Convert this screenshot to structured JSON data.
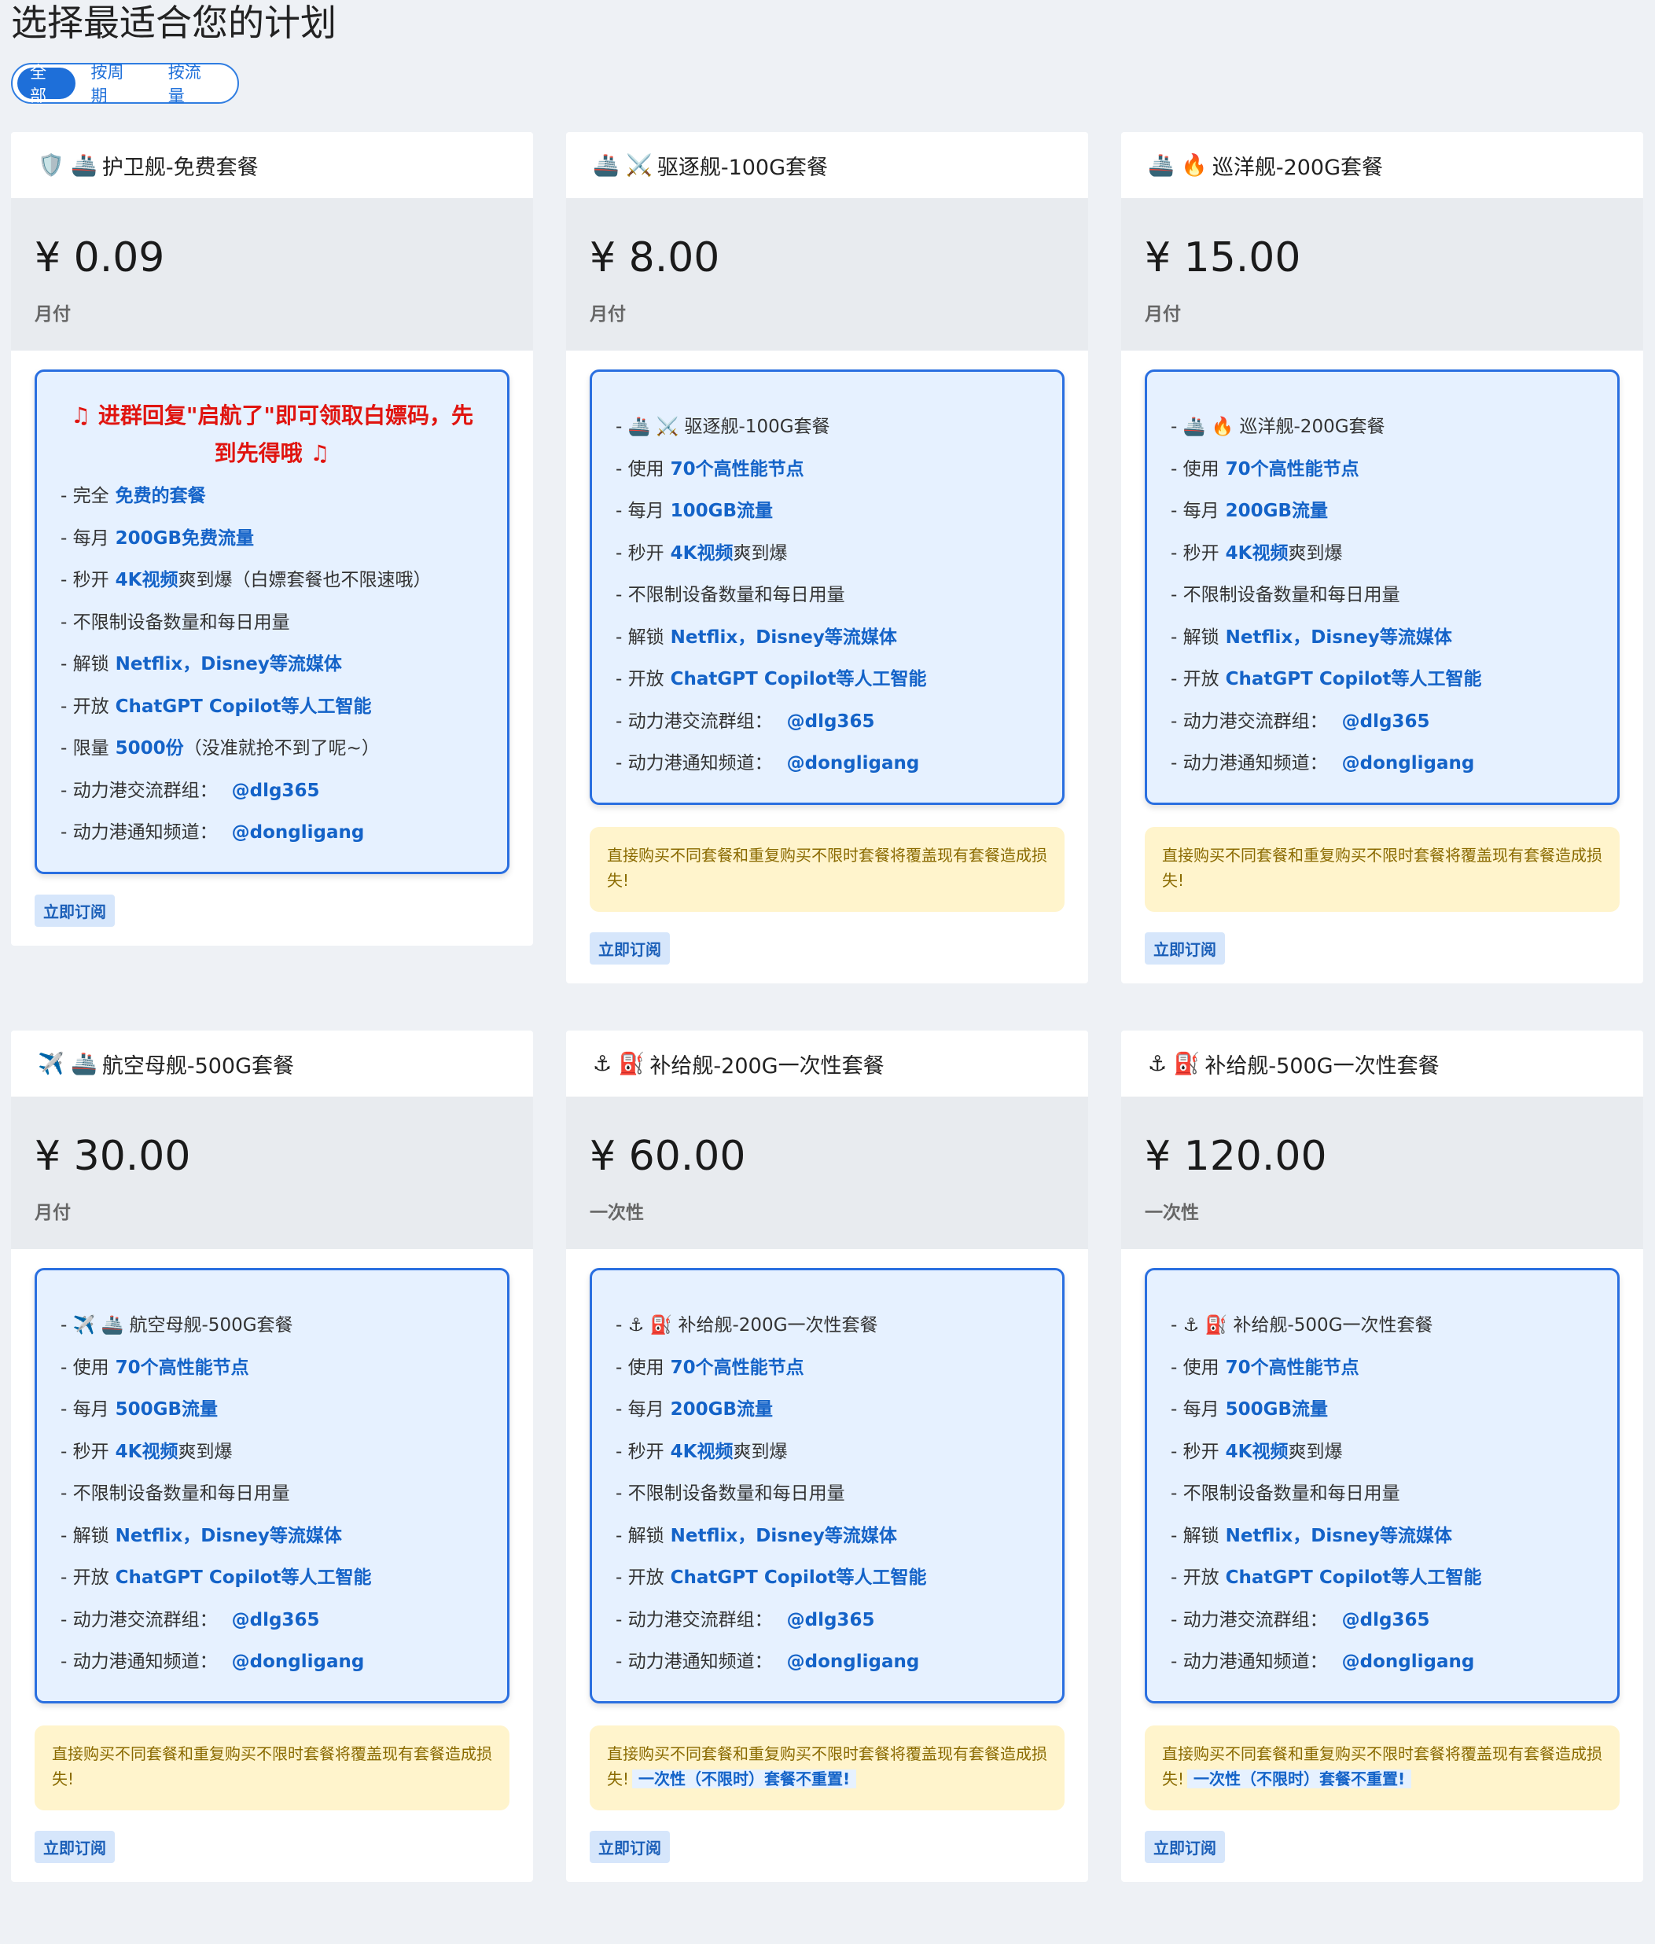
{
  "page_title": "选择最适合您的计划",
  "filters": [
    {
      "label": "全部",
      "active": true
    },
    {
      "label": "按周期",
      "active": false
    },
    {
      "label": "按流量",
      "active": false
    }
  ],
  "subscribe_label": "立即订阅",
  "note_text": "直接购买不同套餐和重复购买不限时套餐将覆盖现有套餐造成损失!",
  "note_extra": "一次性（不限时）套餐不重置!",
  "plans": [
    {
      "emoji": "🛡️ 🚢",
      "name": "护卫舰-免费套餐",
      "price": "¥ 0.09",
      "period": "月付",
      "promo": "♫ 进群回复\"启航了\"即可领取白嫖码，先到先得哦 ♫",
      "lines": [
        {
          "pre": "- 完全",
          "hl": "免费的套餐",
          "post": ""
        },
        {
          "pre": "- 每月",
          "hl": "200GB免费流量",
          "post": ""
        },
        {
          "pre": "- 秒开",
          "hl": "4K视频",
          "post": "爽到爆（白嫖套餐也不限速哦）"
        },
        {
          "pre": "- 不限制设备数量和每日用量",
          "hl": "",
          "post": ""
        },
        {
          "pre": "- 解锁",
          "hl": "Netflix，Disney等流媒体",
          "post": ""
        },
        {
          "pre": "- 开放",
          "hl": "ChatGPT Copilot等人工智能",
          "post": ""
        },
        {
          "pre": "- 限量",
          "hl": "5000份",
          "post": "（没准就抢不到了呢~）"
        },
        {
          "pre": "- 动力港交流群组：",
          "hl": "@dlg365",
          "post": ""
        },
        {
          "pre": "- 动力港通知频道：",
          "hl": "@dongligang",
          "post": ""
        }
      ],
      "note": false,
      "note_extra": false
    },
    {
      "emoji": "🚢 ⚔️",
      "name": "驱逐舰-100G套餐",
      "price": "¥ 8.00",
      "period": "月付",
      "promo": "",
      "lines": [
        {
          "pre": "- 🚢 ⚔️ 驱逐舰-100G套餐",
          "hl": "",
          "post": ""
        },
        {
          "pre": "- 使用",
          "hl": "70个高性能节点",
          "post": ""
        },
        {
          "pre": "- 每月",
          "hl": "100GB流量",
          "post": ""
        },
        {
          "pre": "- 秒开",
          "hl": "4K视频",
          "post": "爽到爆"
        },
        {
          "pre": "- 不限制设备数量和每日用量",
          "hl": "",
          "post": ""
        },
        {
          "pre": "- 解锁",
          "hl": "Netflix，Disney等流媒体",
          "post": ""
        },
        {
          "pre": "- 开放",
          "hl": "ChatGPT Copilot等人工智能",
          "post": ""
        },
        {
          "pre": "- 动力港交流群组：",
          "hl": "@dlg365",
          "post": ""
        },
        {
          "pre": "- 动力港通知频道：",
          "hl": "@dongligang",
          "post": ""
        }
      ],
      "note": true,
      "note_extra": false
    },
    {
      "emoji": "🚢 🔥",
      "name": "巡洋舰-200G套餐",
      "price": "¥ 15.00",
      "period": "月付",
      "promo": "",
      "lines": [
        {
          "pre": "- 🚢 🔥 巡洋舰-200G套餐",
          "hl": "",
          "post": ""
        },
        {
          "pre": "- 使用",
          "hl": "70个高性能节点",
          "post": ""
        },
        {
          "pre": "- 每月",
          "hl": "200GB流量",
          "post": ""
        },
        {
          "pre": "- 秒开",
          "hl": "4K视频",
          "post": "爽到爆"
        },
        {
          "pre": "- 不限制设备数量和每日用量",
          "hl": "",
          "post": ""
        },
        {
          "pre": "- 解锁",
          "hl": "Netflix，Disney等流媒体",
          "post": ""
        },
        {
          "pre": "- 开放",
          "hl": "ChatGPT Copilot等人工智能",
          "post": ""
        },
        {
          "pre": "- 动力港交流群组：",
          "hl": "@dlg365",
          "post": ""
        },
        {
          "pre": "- 动力港通知频道：",
          "hl": "@dongligang",
          "post": ""
        }
      ],
      "note": true,
      "note_extra": false
    },
    {
      "emoji": "✈️ 🚢",
      "name": "航空母舰-500G套餐",
      "price": "¥ 30.00",
      "period": "月付",
      "promo": "",
      "lines": [
        {
          "pre": "- ✈️ 🚢 航空母舰-500G套餐",
          "hl": "",
          "post": ""
        },
        {
          "pre": "- 使用",
          "hl": "70个高性能节点",
          "post": ""
        },
        {
          "pre": "- 每月",
          "hl": "500GB流量",
          "post": ""
        },
        {
          "pre": "- 秒开",
          "hl": "4K视频",
          "post": "爽到爆"
        },
        {
          "pre": "- 不限制设备数量和每日用量",
          "hl": "",
          "post": ""
        },
        {
          "pre": "- 解锁",
          "hl": "Netflix，Disney等流媒体",
          "post": ""
        },
        {
          "pre": "- 开放",
          "hl": "ChatGPT Copilot等人工智能",
          "post": ""
        },
        {
          "pre": "- 动力港交流群组：",
          "hl": "@dlg365",
          "post": ""
        },
        {
          "pre": "- 动力港通知频道：",
          "hl": "@dongligang",
          "post": ""
        }
      ],
      "note": true,
      "note_extra": false
    },
    {
      "emoji": "⚓ ⛽",
      "name": "补给舰-200G一次性套餐",
      "price": "¥ 60.00",
      "period": "一次性",
      "promo": "",
      "lines": [
        {
          "pre": "- ⚓ ⛽ 补给舰-200G一次性套餐",
          "hl": "",
          "post": ""
        },
        {
          "pre": "- 使用",
          "hl": "70个高性能节点",
          "post": ""
        },
        {
          "pre": "- 每月",
          "hl": "200GB流量",
          "post": ""
        },
        {
          "pre": "- 秒开",
          "hl": "4K视频",
          "post": "爽到爆"
        },
        {
          "pre": "- 不限制设备数量和每日用量",
          "hl": "",
          "post": ""
        },
        {
          "pre": "- 解锁",
          "hl": "Netflix，Disney等流媒体",
          "post": ""
        },
        {
          "pre": "- 开放",
          "hl": "ChatGPT Copilot等人工智能",
          "post": ""
        },
        {
          "pre": "- 动力港交流群组：",
          "hl": "@dlg365",
          "post": ""
        },
        {
          "pre": "- 动力港通知频道：",
          "hl": "@dongligang",
          "post": ""
        }
      ],
      "note": true,
      "note_extra": true
    },
    {
      "emoji": "⚓ ⛽",
      "name": "补给舰-500G一次性套餐",
      "price": "¥ 120.00",
      "period": "一次性",
      "promo": "",
      "lines": [
        {
          "pre": "- ⚓ ⛽ 补给舰-500G一次性套餐",
          "hl": "",
          "post": ""
        },
        {
          "pre": "- 使用",
          "hl": "70个高性能节点",
          "post": ""
        },
        {
          "pre": "- 每月",
          "hl": "500GB流量",
          "post": ""
        },
        {
          "pre": "- 秒开",
          "hl": "4K视频",
          "post": "爽到爆"
        },
        {
          "pre": "- 不限制设备数量和每日用量",
          "hl": "",
          "post": ""
        },
        {
          "pre": "- 解锁",
          "hl": "Netflix，Disney等流媒体",
          "post": ""
        },
        {
          "pre": "- 开放",
          "hl": "ChatGPT Copilot等人工智能",
          "post": ""
        },
        {
          "pre": "- 动力港交流群组：",
          "hl": "@dlg365",
          "post": ""
        },
        {
          "pre": "- 动力港通知频道：",
          "hl": "@dongligang",
          "post": ""
        }
      ],
      "note": true,
      "note_extra": true
    }
  ]
}
